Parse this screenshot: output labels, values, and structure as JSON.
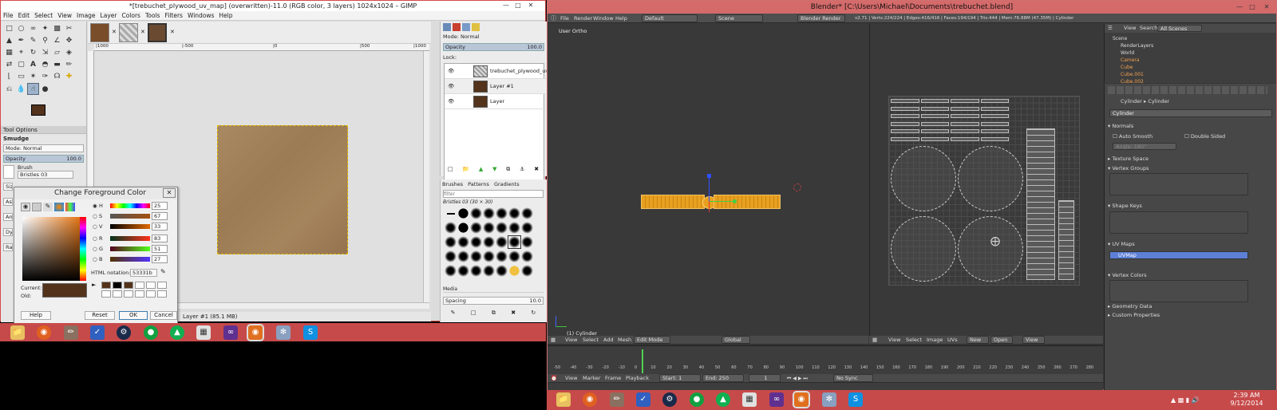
{
  "gimp": {
    "title": "*[trebuchet_plywood_uv_map] (overwritten)-11.0 (RGB color, 3 layers) 1024x1024 – GIMP",
    "menu": [
      "File",
      "Edit",
      "Select",
      "View",
      "Image",
      "Layer",
      "Colors",
      "Tools",
      "Filters",
      "Windows",
      "Help"
    ],
    "ruler_ticks": [
      "|1000",
      "|-500",
      "|0",
      "|500",
      "|1000"
    ],
    "tool_options": {
      "header": "Tool Options",
      "tool": "Smudge",
      "mode_label": "Mode: Normal",
      "opacity_label": "Opacity",
      "opacity_value": "100.0",
      "brush_label": "Brush",
      "brush_value": "Bristles 03",
      "side_labels": [
        "Size",
        "Aspe",
        "Angl",
        "Dyn",
        "Rate"
      ]
    },
    "status_text": "Layer #1 (85.1 MB)",
    "layers_panel": {
      "mode": "Mode: Normal",
      "opacity_label": "Opacity",
      "opacity_value": "100.0",
      "lock_label": "Lock:",
      "layers": [
        {
          "name": "trebuchet_plywood_uv_map.p"
        },
        {
          "name": "Layer #1"
        },
        {
          "name": "Layer"
        }
      ]
    },
    "brushes_panel": {
      "tabs": [
        "Brushes",
        "Patterns",
        "Gradients"
      ],
      "filter_placeholder": "filter",
      "brush_name": "Bristles 03 (30 × 30)",
      "category": "Media",
      "spacing_label": "Spacing",
      "spacing_value": "10.0"
    },
    "fg_dialog": {
      "title": "Change Foreground Color",
      "channels": [
        {
          "label": "H",
          "value": "25"
        },
        {
          "label": "S",
          "value": "67"
        },
        {
          "label": "V",
          "value": "33"
        },
        {
          "label": "R",
          "value": "83"
        },
        {
          "label": "G",
          "value": "51"
        },
        {
          "label": "B",
          "value": "27"
        }
      ],
      "html_label": "HTML notation:",
      "html_value": "53331b",
      "current_label": "Current:",
      "old_label": "Old:",
      "buttons": {
        "help": "Help",
        "reset": "Reset",
        "ok": "OK",
        "cancel": "Cancel"
      }
    }
  },
  "blender": {
    "title": "Blender* [C:\\Users\\Michael\\Documents\\trebuchet.blend]",
    "menu": [
      "File",
      "Render",
      "Window",
      "Help"
    ],
    "layout_dropdown": "Default",
    "scene_dropdown": "Scene",
    "engine_dropdown": "Blender Render",
    "stats": "v2.71 | Verts:224/224 | Edges:416/416 | Faces:194/194 | Tris:444 | Mem:76.88M (47.35M) | Cylinder",
    "viewport_label": "User Ortho",
    "object_label": "(1) Cylinder",
    "viewport_menu": [
      "View",
      "Select",
      "Add",
      "Mesh"
    ],
    "mode_dropdown": "Edit Mode",
    "orientation_dropdown": "Global",
    "uv_menu": [
      "View",
      "Select",
      "Image",
      "UVs"
    ],
    "uv_new": "New",
    "uv_open": "Open",
    "uv_view": "View",
    "outliner": {
      "menu": [
        "View",
        "Search"
      ],
      "scenes_dropdown": "All Scenes",
      "items": [
        "Scene",
        "RenderLayers",
        "World",
        "Camera",
        "Cube",
        "Cube.001",
        "Cube.002"
      ]
    },
    "properties": {
      "breadcrumb": [
        "Cylinder",
        "Cylinder"
      ],
      "mesh_name": "Cylinder",
      "normals_label": "Normals",
      "auto_smooth": "Auto Smooth",
      "double_sided": "Double Sided",
      "angle_label": "Angle:",
      "angle_value": "180°",
      "sections": [
        "Texture Space",
        "Vertex Groups",
        "Shape Keys",
        "UV Maps",
        "Vertex Colors",
        "Geometry Data",
        "Custom Properties"
      ],
      "uvmap_name": "UVMap"
    },
    "timeline": {
      "ticks": [
        "-50",
        "-40",
        "-30",
        "-20",
        "-10",
        "0",
        "10",
        "20",
        "30",
        "40",
        "50",
        "60",
        "70",
        "80",
        "90",
        "100",
        "110",
        "120",
        "130",
        "140",
        "150",
        "160",
        "170",
        "180",
        "190",
        "200",
        "210",
        "220",
        "230",
        "240",
        "250",
        "260",
        "270",
        "280"
      ],
      "menu": [
        "View",
        "Marker",
        "Frame",
        "Playback"
      ],
      "start_label": "Start:",
      "start_value": "1",
      "end_label": "End:",
      "end_value": "250",
      "current_frame": "1",
      "sync": "No Sync"
    }
  },
  "taskbar": {
    "time": "2:39 AM",
    "date": "9/12/2014"
  },
  "colors": {
    "fg_color": "#53331b",
    "blender_title_bg": "#d46a6a",
    "taskbar_bg": "#c74a4a",
    "uv_selected_blue": "#5d7fd6",
    "mesh_orange": "#e8a020"
  }
}
